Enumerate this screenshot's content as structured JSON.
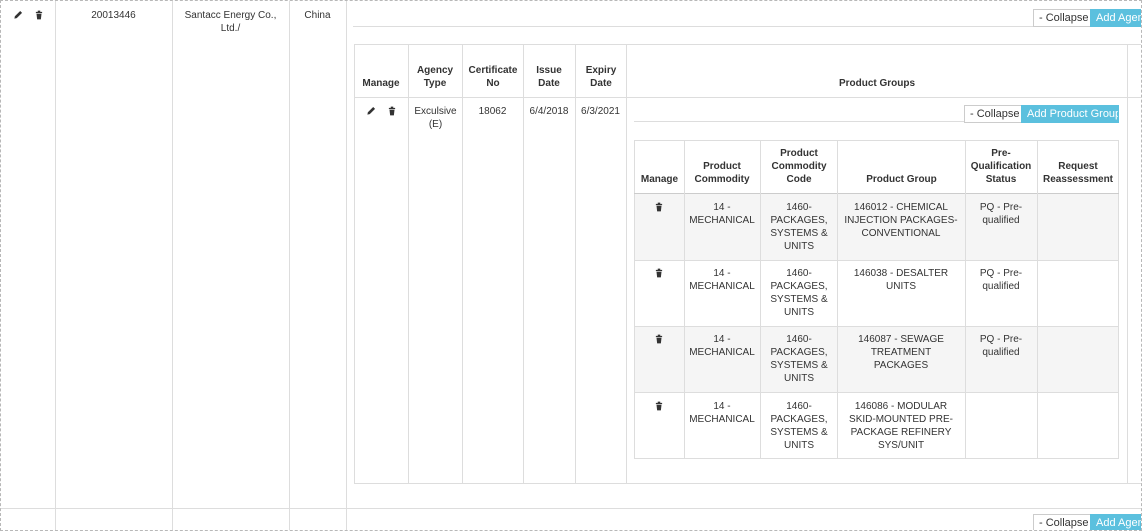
{
  "outer_row": {
    "id": "20013446",
    "company": "Santacc Energy Co., Ltd./",
    "country": "China",
    "collapse_label": "- Collapse",
    "add_label": "Add Agency"
  },
  "agency_table": {
    "headers": [
      "Manage",
      "Agency Type",
      "Certificate No",
      "Issue Date",
      "Expiry Date",
      "Product Groups"
    ],
    "row": {
      "agency_type": "Exculsive (E)",
      "certificate_no": "18062",
      "issue_date": "6/4/2018",
      "expiry_date": "6/3/2021"
    }
  },
  "product_groups": {
    "collapse_label": "- Collapse",
    "add_label": "Add Product Group",
    "headers": [
      "Manage",
      "Product Commodity",
      "Product Commodity Code",
      "Product Group",
      "Pre-Qualification Status",
      "Request Reassessment"
    ],
    "rows": [
      {
        "commodity": "14 - MECHANICAL",
        "code": "1460-PACKAGES, SYSTEMS & UNITS",
        "group": "146012 - CHEMICAL INJECTION PACKAGES-CONVENTIONAL",
        "status": "PQ - Pre-qualified",
        "reassessment": ""
      },
      {
        "commodity": "14 - MECHANICAL",
        "code": "1460-PACKAGES, SYSTEMS & UNITS",
        "group": "146038 - DESALTER UNITS",
        "status": "PQ - Pre-qualified",
        "reassessment": ""
      },
      {
        "commodity": "14 - MECHANICAL",
        "code": "1460-PACKAGES, SYSTEMS & UNITS",
        "group": "146087 - SEWAGE TREATMENT PACKAGES",
        "status": "PQ - Pre-qualified",
        "reassessment": ""
      },
      {
        "commodity": "14 - MECHANICAL",
        "code": "1460-PACKAGES, SYSTEMS & UNITS",
        "group": "146086 - MODULAR SKID-MOUNTED PRE-PACKAGE REFINERY SYS/UNIT",
        "status": "",
        "reassessment": ""
      }
    ]
  },
  "next_row": {
    "collapse_label": "- Collapse",
    "add_label": "Add Agency"
  },
  "icons": {
    "edit": "pencil-icon",
    "delete": "trash-icon"
  }
}
